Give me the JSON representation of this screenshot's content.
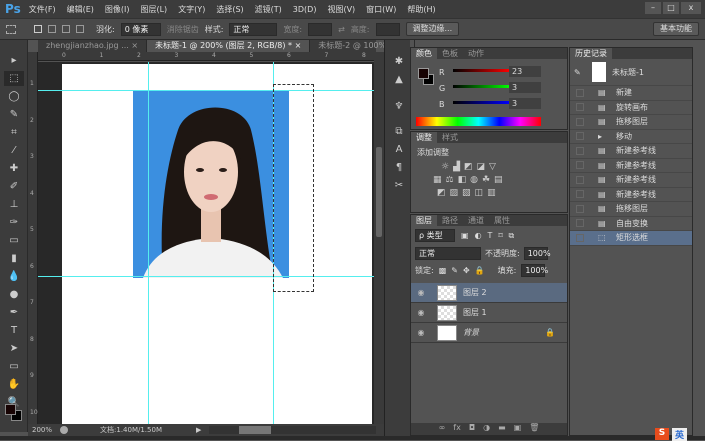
{
  "app": {
    "logo": "Ps",
    "menus": [
      "文件(F)",
      "编辑(E)",
      "图像(I)",
      "图层(L)",
      "文字(Y)",
      "选择(S)",
      "滤镜(T)",
      "3D(D)",
      "视图(V)",
      "窗口(W)",
      "帮助(H)"
    ],
    "window_buttons": [
      "–",
      "□",
      "x"
    ]
  },
  "options": {
    "feather_label": "羽化:",
    "feather_value": "0 像素",
    "antialias_label": "消除锯齿",
    "style_label": "样式:",
    "style_value": "正常",
    "width_label": "宽度:",
    "height_label": "高度:",
    "refine_edge": "调整边缘...",
    "workspace": "基本功能"
  },
  "tabs": [
    {
      "label": "zhengjianzhao.jpg ...",
      "close": "×"
    },
    {
      "label": "未标题-1 @ 200% (图层 2, RGB/8) *",
      "close": "×"
    },
    {
      "label": "未标题-2 @ 100%(...",
      "close": "×"
    }
  ],
  "ruler": {
    "h": [
      "0",
      "1",
      "2",
      "3",
      "4",
      "5",
      "6",
      "7",
      "8"
    ],
    "v": [
      "1",
      "2",
      "3",
      "4",
      "5",
      "6",
      "7",
      "8",
      "9",
      "10"
    ]
  },
  "status": {
    "zoom": "200%",
    "doc": "文档:1.40M/1.50M"
  },
  "color_panel": {
    "tabs": [
      "颜色",
      "色板",
      "动作"
    ],
    "r_label": "R",
    "g_label": "G",
    "b_label": "B",
    "r": "23",
    "g": "3",
    "b": "3",
    "foreground": "#170303"
  },
  "adjust_panel": {
    "tabs": [
      "调整",
      "样式"
    ],
    "title": "添加调整"
  },
  "layers_panel": {
    "tabs": [
      "图层",
      "路径",
      "通道",
      "属性"
    ],
    "filter": "ρ 类型",
    "blend": "正常",
    "opacity_label": "不透明度:",
    "opacity": "100%",
    "lock_label": "锁定:",
    "fill_label": "填充:",
    "fill": "100%",
    "layers": [
      {
        "name": "图层 2",
        "selected": true
      },
      {
        "name": "图层 1",
        "selected": false
      },
      {
        "name": "背景",
        "selected": false,
        "locked": true
      }
    ]
  },
  "history_panel": {
    "tab": "历史记录",
    "snapshot": "未标题-1",
    "items": [
      {
        "label": "新建"
      },
      {
        "label": "旋转画布"
      },
      {
        "label": "拖移图层"
      },
      {
        "label": "移动"
      },
      {
        "label": "新建参考线"
      },
      {
        "label": "新建参考线"
      },
      {
        "label": "新建参考线"
      },
      {
        "label": "新建参考线"
      },
      {
        "label": "拖移图层"
      },
      {
        "label": "自由变换"
      },
      {
        "label": "矩形选框",
        "selected": true
      }
    ]
  },
  "colors": {
    "accent": "#3b8fe0",
    "guide": "#55eeee",
    "selection": "#5a6a80"
  }
}
